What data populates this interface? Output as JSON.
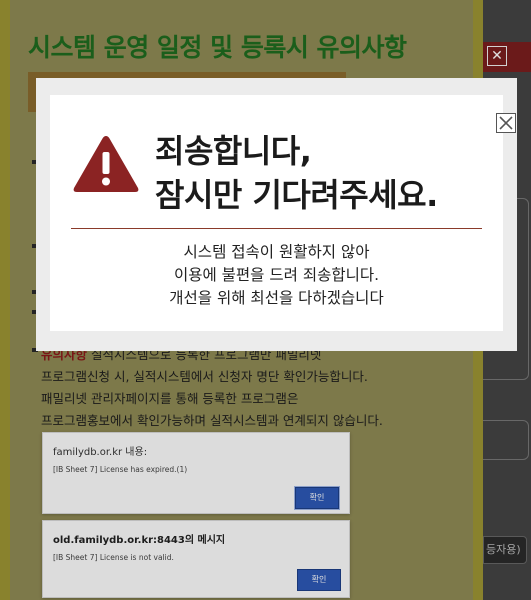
{
  "background_page": {
    "close_glyph": "✕",
    "side_button_label": "등자용)"
  },
  "notice_panel": {
    "title": "시스템 운영 일정 및 등록시 유의사항",
    "notice_highlight": "유의사항",
    "notice_lines": [
      "실적시스템으로 등록한 프로그램만 패밀리넷",
      "프로그램신청 시, 실적시스템에서 신청자 명단 확인가능합니다.",
      "패밀리넷 관리자페이지를 통해 등록한 프로그램은",
      "프로그램홍보에서 확인가능하며 실적시스템과 연계되지 않습니다."
    ],
    "dialogs": [
      {
        "host": "familydb.or.kr 내용:",
        "message": "[IB Sheet 7] License has expired.(1)",
        "ok_label": "확인"
      },
      {
        "host": "old.familydb.or.kr:8443의 메시지",
        "message": "[IB Sheet 7] License is not valid.",
        "ok_label": "확인"
      }
    ]
  },
  "error_modal": {
    "headline_line1": "죄송합니다,",
    "headline_line2": "잠시만 기다려주세요.",
    "body_lines": [
      "시스템 접속이 원활하지 않아",
      "이용에 불편을 드려 죄송합니다.",
      "개선을 위해 최선을 다하겠습니다"
    ],
    "close_icon": "close-icon",
    "warning_icon": "warning-triangle-icon"
  },
  "colors": {
    "warning_red": "#8b2323",
    "title_green": "#1f6b1f",
    "confirm_blue": "#2d58b5"
  }
}
